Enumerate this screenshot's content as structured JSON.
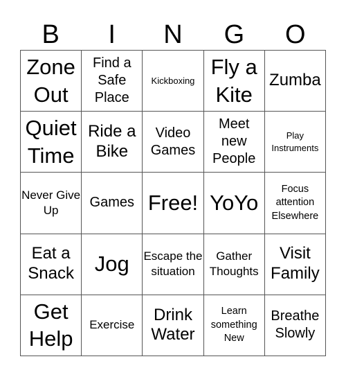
{
  "header": [
    "B",
    "I",
    "N",
    "G",
    "O"
  ],
  "cells": [
    {
      "text": "Zone Out",
      "size": "xl"
    },
    {
      "text": "Find a Safe Place",
      "size": "m"
    },
    {
      "text": "Kickboxing",
      "size": "xs"
    },
    {
      "text": "Fly a Kite",
      "size": "xl"
    },
    {
      "text": "Zumba",
      "size": "l"
    },
    {
      "text": "Quiet Time",
      "size": "xl"
    },
    {
      "text": "Ride a Bike",
      "size": "l"
    },
    {
      "text": "Video Games",
      "size": "m"
    },
    {
      "text": "Meet new People",
      "size": "m"
    },
    {
      "text": "Play Instruments",
      "size": "xs"
    },
    {
      "text": "Never Give Up",
      "size": "sm"
    },
    {
      "text": "Games",
      "size": "m"
    },
    {
      "text": "Free!",
      "size": "xl"
    },
    {
      "text": "YoYo",
      "size": "xl"
    },
    {
      "text": "Focus attention Elsewhere",
      "size": "s"
    },
    {
      "text": "Eat a Snack",
      "size": "l"
    },
    {
      "text": "Jog",
      "size": "xl"
    },
    {
      "text": "Escape the situation",
      "size": "sm"
    },
    {
      "text": "Gather Thoughts",
      "size": "sm"
    },
    {
      "text": "Visit Family",
      "size": "l"
    },
    {
      "text": "Get Help",
      "size": "xl"
    },
    {
      "text": "Exercise",
      "size": "sm"
    },
    {
      "text": "Drink Water",
      "size": "l"
    },
    {
      "text": "Learn something New",
      "size": "s"
    },
    {
      "text": "Breathe Slowly",
      "size": "m"
    }
  ]
}
